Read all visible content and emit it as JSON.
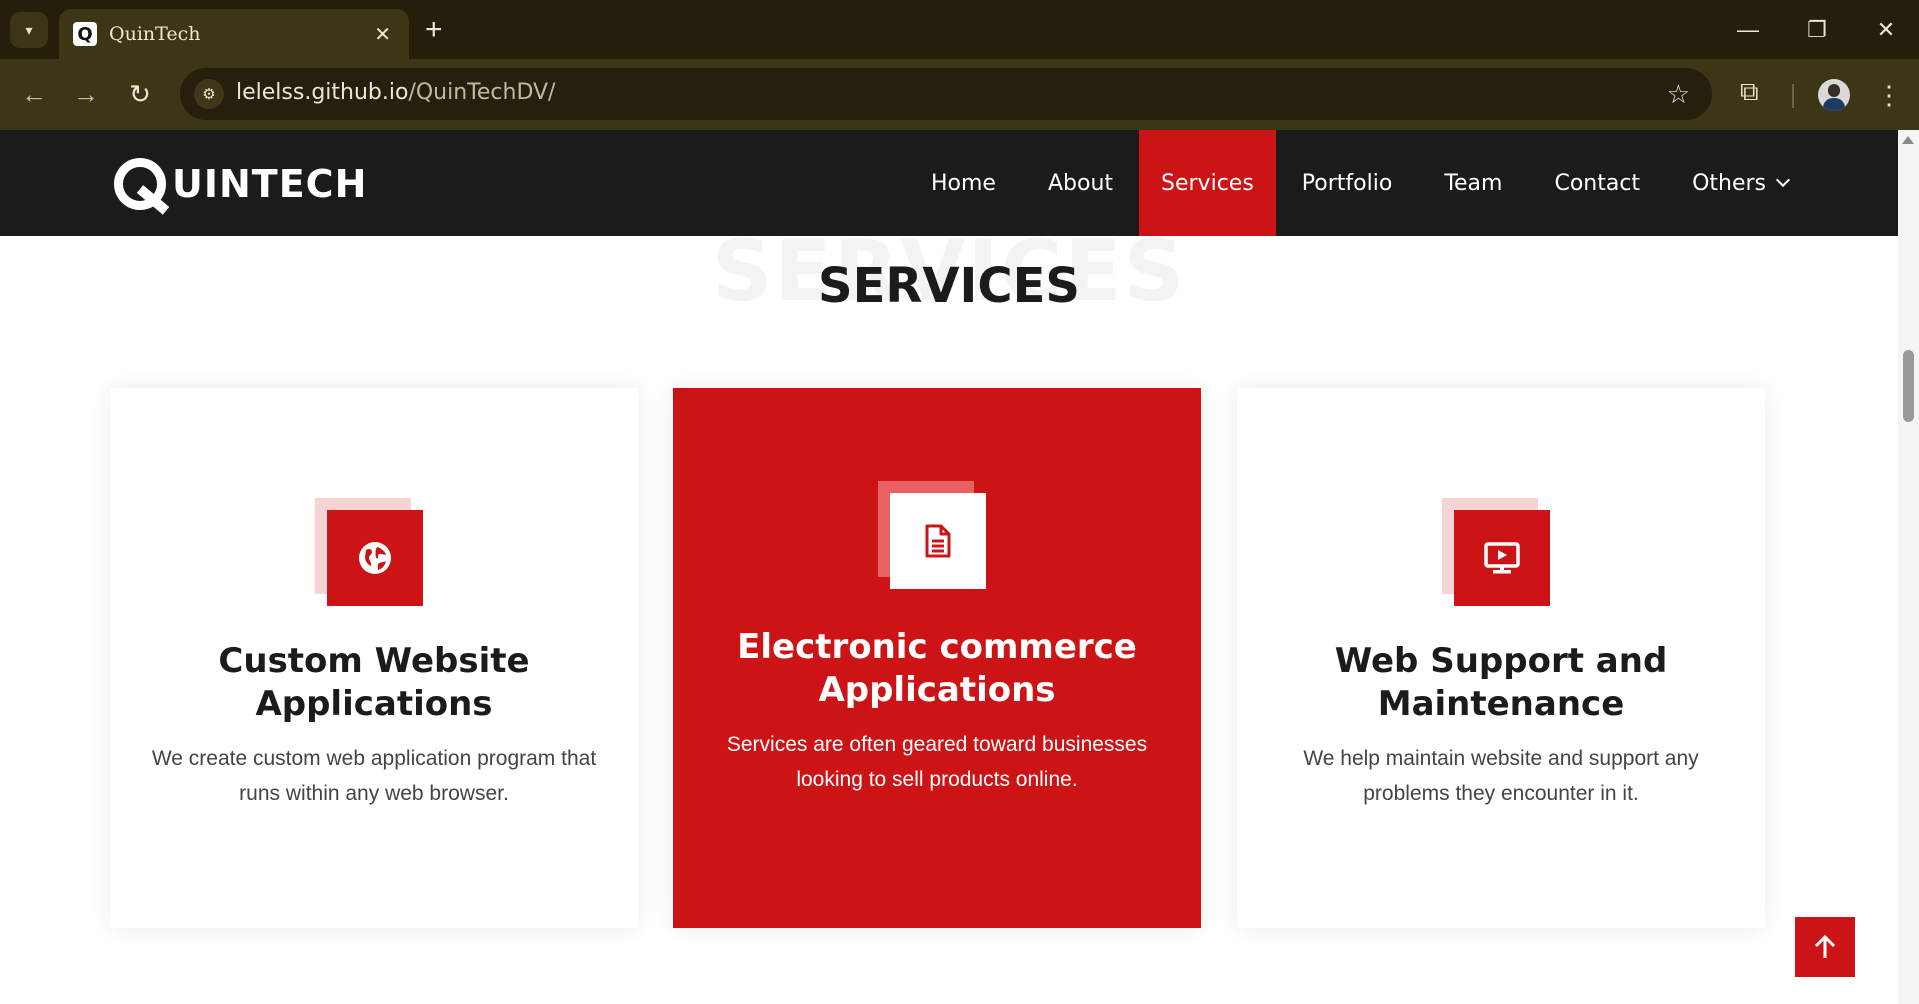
{
  "browser": {
    "tab_title": "QuinTech",
    "tab_favicon": "Q",
    "close_glyph": "✕",
    "new_tab_glyph": "+",
    "url_host": "lelelss.github.io",
    "url_path": "/QuinTechDV/"
  },
  "site": {
    "logo_text": "UINTECH",
    "nav": {
      "home": "Home",
      "about": "About",
      "services": "Services",
      "portfolio": "Portfolio",
      "team": "Team",
      "contact": "Contact",
      "others": "Others"
    },
    "active_nav": "Services",
    "accent_color": "#cc1416"
  },
  "section": {
    "background_word": "SERVICES",
    "title": "SERVICES"
  },
  "services": [
    {
      "icon": "globe-icon",
      "title": "Custom Website Applications",
      "description": "We create custom web application program that runs within any web browser."
    },
    {
      "icon": "document-icon",
      "title": "Electronic commerce Applications",
      "description": "Services are often geared toward businesses looking to sell products online.",
      "featured": true
    },
    {
      "icon": "monitor-play-icon",
      "title": "Web Support and Maintenance",
      "description": "We help maintain website and support any problems they encounter in it."
    }
  ]
}
